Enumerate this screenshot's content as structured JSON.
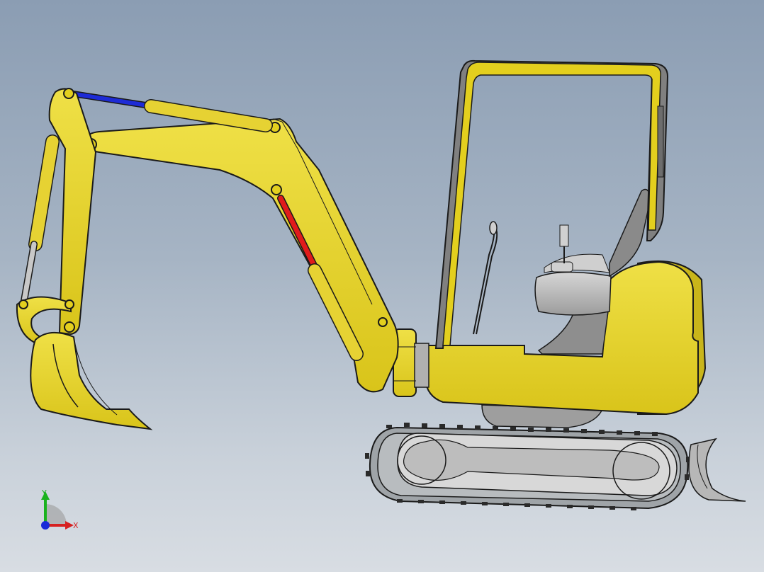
{
  "viewport": {
    "background_top": "#8b9db3",
    "background_bottom": "#d8dde3"
  },
  "model": {
    "body_color": "#e3cf1e",
    "outline_color": "#1a1a1a",
    "cylinder_blue": "#1d2bd6",
    "cylinder_red": "#e01b1b",
    "gray_part": "#b9b9b9"
  },
  "triad": {
    "y_label": "Y",
    "x_label": "X",
    "y_color": "#19b21d",
    "x_color": "#d62020",
    "z_color": "#1a2bd8"
  }
}
